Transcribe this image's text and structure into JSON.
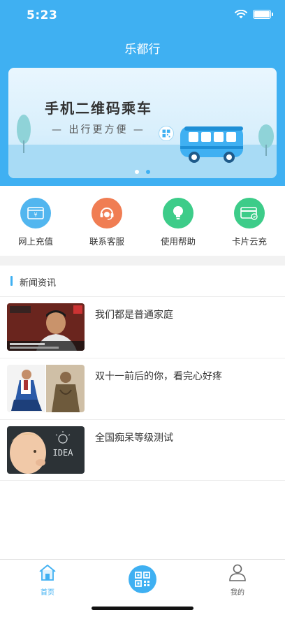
{
  "status_bar": {
    "time": "5:23"
  },
  "header": {
    "title": "乐都行"
  },
  "banner": {
    "title": "手机二维码乘车",
    "subtitle": "— 出行更方便 —",
    "page_count": 2,
    "active_page": 2
  },
  "quick_actions": [
    {
      "label": "网上充值",
      "icon": "wallet-icon",
      "color": "#52b6ef"
    },
    {
      "label": "联系客服",
      "icon": "headset-icon",
      "color": "#f07d53"
    },
    {
      "label": "使用帮助",
      "icon": "lightbulb-icon",
      "color": "#3dcc89"
    },
    {
      "label": "卡片云充",
      "icon": "card-icon",
      "color": "#3dcc89"
    }
  ],
  "news": {
    "section_title": "新闻资讯",
    "items": [
      {
        "title": "我们都是普通家庭"
      },
      {
        "title": "双十一前后的你，看完心好疼"
      },
      {
        "title": "全国痴呆等级测试"
      }
    ]
  },
  "tabbar": {
    "home_label": "首页",
    "mine_label": "我的"
  },
  "colors": {
    "primary": "#3fb0f2",
    "divider": "#ececec",
    "section_gap": "#f2f2f2"
  }
}
